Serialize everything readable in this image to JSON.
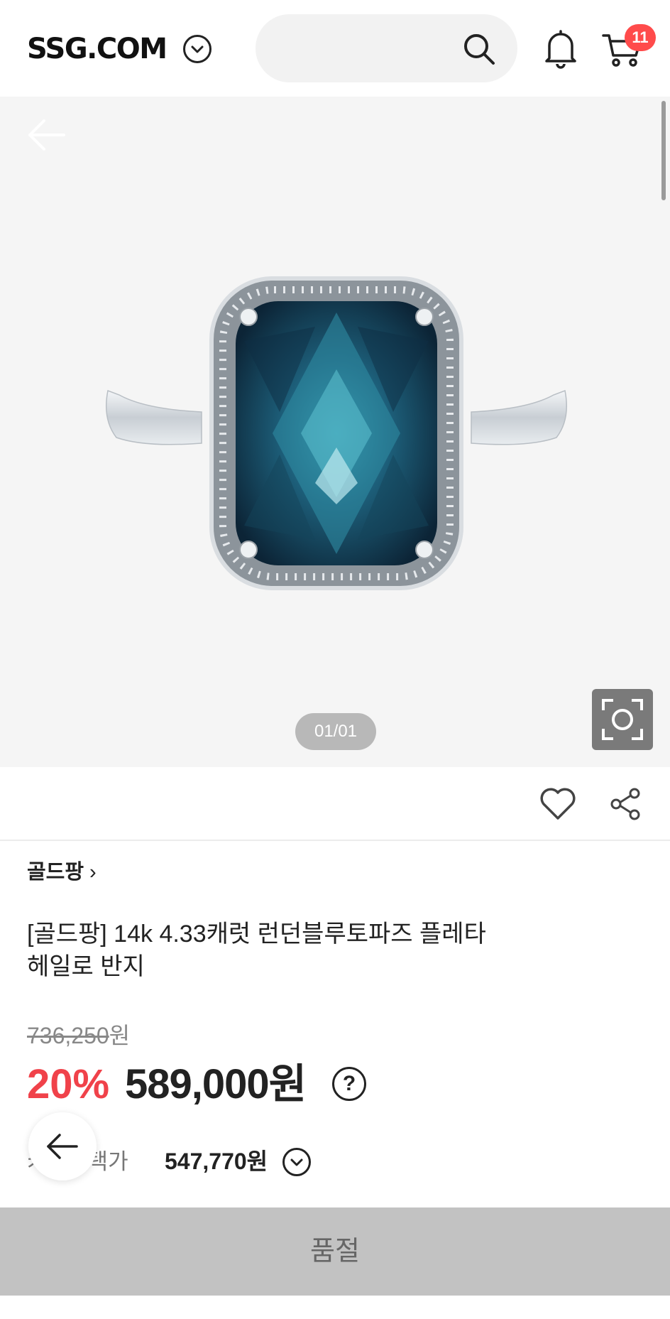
{
  "header": {
    "logo": "SSG.COM",
    "search_placeholder": "",
    "cart_count": "11"
  },
  "gallery": {
    "pager": "01/01"
  },
  "product": {
    "brand": "골드팡",
    "brand_chevron": "›",
    "title_line1": "[골드팡] 14k 4.33캐럿 런던블루토파즈 플레타",
    "title_line2": "헤일로 반지",
    "original_price": "736,250",
    "original_price_unit": "원",
    "discount": "20%",
    "sale_price": "589,000원",
    "help_symbol": "?",
    "card_label": "카드혜택가",
    "card_price": "547,770원"
  },
  "bottom": {
    "soldout_label": "품절"
  },
  "colors": {
    "discount_red": "#f0424a",
    "badge_red": "#ff4b4b",
    "soldout_bg": "#c2c2c2"
  },
  "icons": [
    "chevron-down-icon",
    "search-icon",
    "bell-icon",
    "cart-icon",
    "back-arrow-icon",
    "camera-search-icon",
    "heart-icon",
    "share-icon",
    "help-icon"
  ]
}
